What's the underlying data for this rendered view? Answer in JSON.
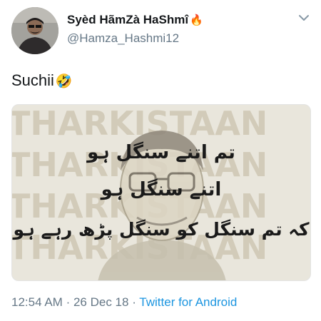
{
  "tweet": {
    "display_name": "Syèd HãmZà HaShmî",
    "handle": "@Hamza_Hashmi12",
    "text": "Suchii",
    "time": "12:54 AM",
    "date": "26 Dec 18",
    "separator": "·",
    "source": "Twitter for Android"
  },
  "icons": {
    "name_emoji": "fire-icon",
    "text_emoji": "laughing-face-icon",
    "menu": "chevron-down-icon"
  },
  "image": {
    "watermark": "THARKISTAAN",
    "lines": [
      "تم اتنے سنگل ہو",
      "اتنے سنگل ہو",
      "کہ تم سنگل کو سنگل پڑھ رہے ہو"
    ]
  },
  "colors": {
    "text": "#14171a",
    "secondary": "#657786",
    "link": "#1b95e0",
    "image_bg": "#e9e6dc",
    "watermark": "#d2cbb9"
  }
}
